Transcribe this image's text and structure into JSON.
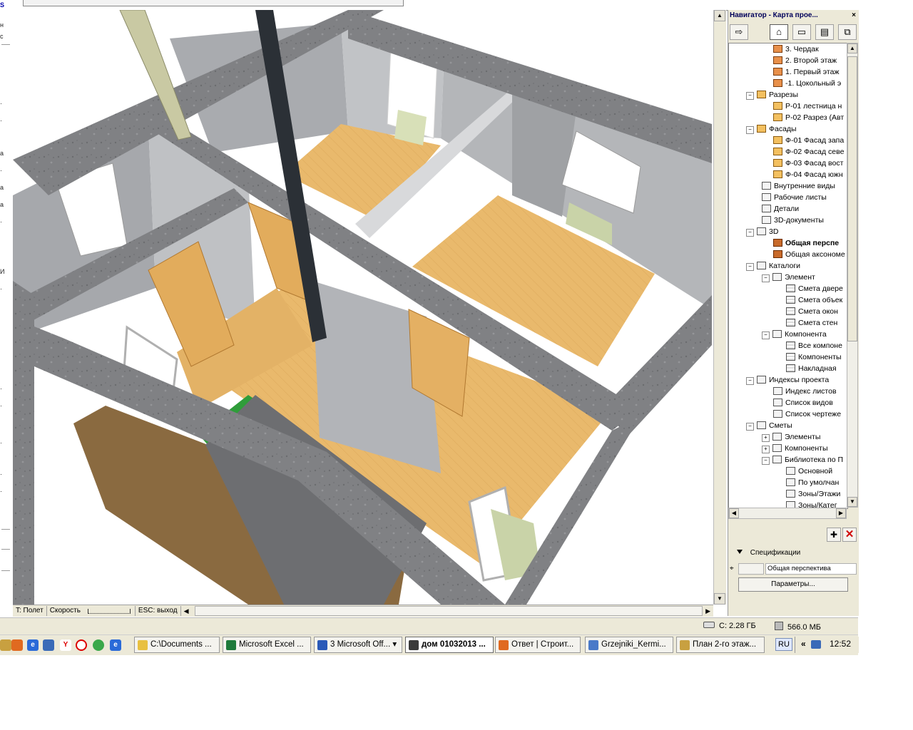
{
  "navigator": {
    "title": "Навигатор - Карта прое...",
    "close": "×",
    "tree": [
      {
        "label": "3. Чердак",
        "icon": "story-icon",
        "indent": 3
      },
      {
        "label": "2. Второй этаж",
        "icon": "story-icon",
        "indent": 3
      },
      {
        "label": "1. Первый этаж",
        "icon": "story-icon",
        "indent": 3
      },
      {
        "label": "-1. Цокольный э",
        "icon": "story-icon",
        "indent": 3
      },
      {
        "label": "Разрезы",
        "icon": "section-folder-icon",
        "indent": 1,
        "expand": "−"
      },
      {
        "label": "Р-01 лестница н",
        "icon": "section-icon",
        "indent": 3
      },
      {
        "label": "Р-02 Разрез (Авт",
        "icon": "section-icon",
        "indent": 3
      },
      {
        "label": "Фасады",
        "icon": "elevation-folder-icon",
        "indent": 1,
        "expand": "−"
      },
      {
        "label": "Ф-01 Фасад запа",
        "icon": "elevation-icon",
        "indent": 3
      },
      {
        "label": "Ф-02 Фасад севе",
        "icon": "elevation-icon",
        "indent": 3
      },
      {
        "label": "Ф-03 Фасад вост",
        "icon": "elevation-icon",
        "indent": 3
      },
      {
        "label": "Ф-04 Фасад южн",
        "icon": "elevation-icon",
        "indent": 3
      },
      {
        "label": "Внутренние виды",
        "icon": "interior-view-icon",
        "indent": 2
      },
      {
        "label": "Рабочие листы",
        "icon": "worksheet-icon",
        "indent": 2
      },
      {
        "label": "Детали",
        "icon": "detail-icon",
        "indent": 2
      },
      {
        "label": "3D-документы",
        "icon": "3d-document-icon",
        "indent": 2
      },
      {
        "label": "3D",
        "icon": "3d-folder-icon",
        "indent": 1,
        "expand": "−"
      },
      {
        "label": "Общая перспе",
        "icon": "perspective-camera-icon",
        "indent": 3,
        "bold": true
      },
      {
        "label": "Общая аксономе",
        "icon": "axonometry-icon",
        "indent": 3
      },
      {
        "label": "Каталоги",
        "icon": "catalog-folder-icon",
        "indent": 1,
        "expand": "−"
      },
      {
        "label": "Элемент",
        "icon": "element-catalog-icon",
        "indent": 2,
        "expand": "−"
      },
      {
        "label": "Смета двере",
        "icon": "schedule-icon",
        "indent": 4
      },
      {
        "label": "Смета объек",
        "icon": "schedule-icon",
        "indent": 4
      },
      {
        "label": "Смета окон",
        "icon": "schedule-icon",
        "indent": 4
      },
      {
        "label": "Смета стен",
        "icon": "schedule-icon",
        "indent": 4
      },
      {
        "label": "Компонента",
        "icon": "component-catalog-icon",
        "indent": 2,
        "expand": "−"
      },
      {
        "label": "Все компоне",
        "icon": "schedule-icon",
        "indent": 4
      },
      {
        "label": "Компоненты",
        "icon": "schedule-icon",
        "indent": 4
      },
      {
        "label": "Накладная",
        "icon": "schedule-icon",
        "indent": 4
      },
      {
        "label": "Индексы проекта",
        "icon": "project-index-icon",
        "indent": 1,
        "expand": "−"
      },
      {
        "label": "Индекс листов",
        "icon": "index-icon",
        "indent": 3
      },
      {
        "label": "Список видов",
        "icon": "index-icon",
        "indent": 3
      },
      {
        "label": "Список чертеже",
        "icon": "index-icon",
        "indent": 3
      },
      {
        "label": "Сметы",
        "icon": "lists-folder-icon",
        "indent": 1,
        "expand": "−"
      },
      {
        "label": "Элементы",
        "icon": "element-list-icon",
        "indent": 2,
        "expand": "+"
      },
      {
        "label": "Компоненты",
        "icon": "component-list-icon",
        "indent": 2,
        "expand": "+"
      },
      {
        "label": "Библиотека по П",
        "icon": "library-list-icon",
        "indent": 2,
        "expand": "−"
      },
      {
        "label": "Основной",
        "icon": "list-doc-icon",
        "indent": 4
      },
      {
        "label": "По умолчан",
        "icon": "list-doc-icon",
        "indent": 4
      },
      {
        "label": "Зоны/Этажи",
        "icon": "list-doc-icon",
        "indent": 4
      },
      {
        "label": "Зоны/Катег",
        "icon": "list-doc-icon",
        "indent": 4
      }
    ],
    "specs_label": "Спецификации",
    "view_name": "Общая перспектива",
    "params_button": "Параметры..."
  },
  "status": {
    "mode": "T: Полет",
    "speed": "Скорость",
    "esc": "ESC: выход"
  },
  "info": {
    "disk": "C: 2.28 ГБ",
    "memory": "566.0 МБ"
  },
  "taskbar": {
    "tasks": [
      {
        "label": "C:\\Documents ...",
        "icon_color": "#e8c040"
      },
      {
        "label": "Microsoft Excel ...",
        "icon_color": "#1e7a3a"
      },
      {
        "label": "3 Microsoft Off... ▾",
        "icon_color": "#2a5ab8"
      },
      {
        "label": "дом 01032013 ...",
        "icon_color": "#3a3a3a"
      },
      {
        "label": "Ответ | Строит...",
        "icon_color": "#e06a20"
      },
      {
        "label": "Grzejniki_Kermi...",
        "icon_color": "#4a7ac8"
      },
      {
        "label": "План 2-го этаж...",
        "icon_color": "#c8a040"
      }
    ],
    "language": "RU",
    "clock": "12:52"
  },
  "colors": {
    "floor": "#e8b86a",
    "wall": "#b9bbbf",
    "concrete": "#7c7d80",
    "stair": "#2f9d3a"
  }
}
